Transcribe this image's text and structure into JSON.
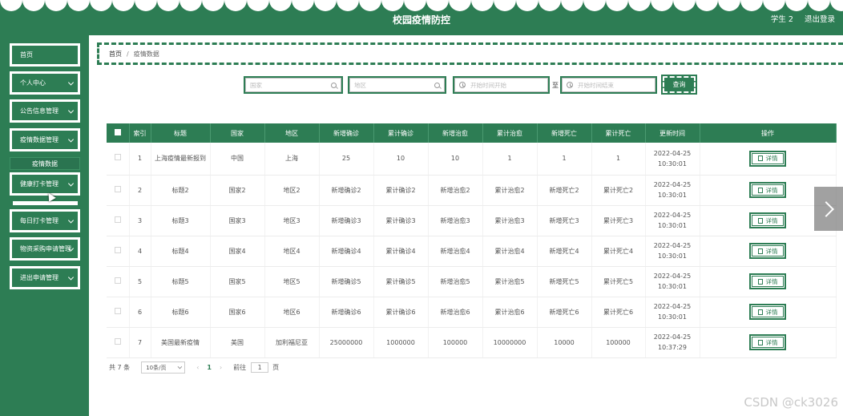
{
  "app": {
    "title": "校园疫情防控",
    "user": "学生 2",
    "logout": "退出登录"
  },
  "sidebar": {
    "items": [
      {
        "label": "首页",
        "has_children": false
      },
      {
        "label": "个人中心",
        "has_children": true
      },
      {
        "label": "公告信息管理",
        "has_children": true
      },
      {
        "label": "疫情数据管理",
        "has_children": true
      },
      {
        "label": "健康打卡管理",
        "has_children": true
      },
      {
        "label": "每日打卡管理",
        "has_children": true
      },
      {
        "label": "物资采购申请管理",
        "has_children": true
      },
      {
        "label": "进出申请管理",
        "has_children": true
      }
    ],
    "submenu_label": "疫情数据"
  },
  "breadcrumb": {
    "home": "首页",
    "separator": "/",
    "current": "疫情数据"
  },
  "search": {
    "country_placeholder": "国家",
    "region_placeholder": "地区",
    "start_placeholder": "开始时间开始",
    "end_placeholder": "开始时间结束",
    "to_label": "至",
    "query_button": "查询"
  },
  "table": {
    "headers": [
      "索引",
      "标题",
      "国家",
      "地区",
      "新增确诊",
      "累计确诊",
      "新增治愈",
      "累计治愈",
      "新增死亡",
      "累计死亡",
      "更新时间",
      "操作"
    ],
    "detail_label": "详情",
    "rows": [
      {
        "index": "1",
        "title": "上海疫情最新报到",
        "country": "中国",
        "region": "上海",
        "new_confirmed": "25",
        "total_confirmed": "10",
        "new_cured": "10",
        "total_cured": "1",
        "new_deaths": "1",
        "total_deaths": "1",
        "updated": "2022-04-25 10:30:01"
      },
      {
        "index": "2",
        "title": "标题2",
        "country": "国家2",
        "region": "地区2",
        "new_confirmed": "新增确诊2",
        "total_confirmed": "累计确诊2",
        "new_cured": "新增治愈2",
        "total_cured": "累计治愈2",
        "new_deaths": "新增死亡2",
        "total_deaths": "累计死亡2",
        "updated": "2022-04-25 10:30:01"
      },
      {
        "index": "3",
        "title": "标题3",
        "country": "国家3",
        "region": "地区3",
        "new_confirmed": "新增确诊3",
        "total_confirmed": "累计确诊3",
        "new_cured": "新增治愈3",
        "total_cured": "累计治愈3",
        "new_deaths": "新增死亡3",
        "total_deaths": "累计死亡3",
        "updated": "2022-04-25 10:30:01"
      },
      {
        "index": "4",
        "title": "标题4",
        "country": "国家4",
        "region": "地区4",
        "new_confirmed": "新增确诊4",
        "total_confirmed": "累计确诊4",
        "new_cured": "新增治愈4",
        "total_cured": "累计治愈4",
        "new_deaths": "新增死亡4",
        "total_deaths": "累计死亡4",
        "updated": "2022-04-25 10:30:01"
      },
      {
        "index": "5",
        "title": "标题5",
        "country": "国家5",
        "region": "地区5",
        "new_confirmed": "新增确诊5",
        "total_confirmed": "累计确诊5",
        "new_cured": "新增治愈5",
        "total_cured": "累计治愈5",
        "new_deaths": "新增死亡5",
        "total_deaths": "累计死亡5",
        "updated": "2022-04-25 10:30:01"
      },
      {
        "index": "6",
        "title": "标题6",
        "country": "国家6",
        "region": "地区6",
        "new_confirmed": "新增确诊6",
        "total_confirmed": "累计确诊6",
        "new_cured": "新增治愈6",
        "total_cured": "累计治愈6",
        "new_deaths": "新增死亡6",
        "total_deaths": "累计死亡6",
        "updated": "2022-04-25 10:30:01"
      },
      {
        "index": "7",
        "title": "美国最新疫情",
        "country": "美国",
        "region": "加利福尼亚",
        "new_confirmed": "25000000",
        "total_confirmed": "1000000",
        "new_cured": "100000",
        "total_cured": "10000000",
        "new_deaths": "10000",
        "total_deaths": "100000",
        "updated": "2022-04-25 10:37:29"
      }
    ]
  },
  "pagination": {
    "total": "共 7 条",
    "page_size": "10条/页",
    "current_page": "1",
    "goto_label": "前往",
    "goto_value": "1",
    "page_suffix": "页"
  },
  "watermark": "CSDN @ck3026",
  "colors": {
    "primary": "#2d7d54",
    "white": "#ffffff"
  }
}
